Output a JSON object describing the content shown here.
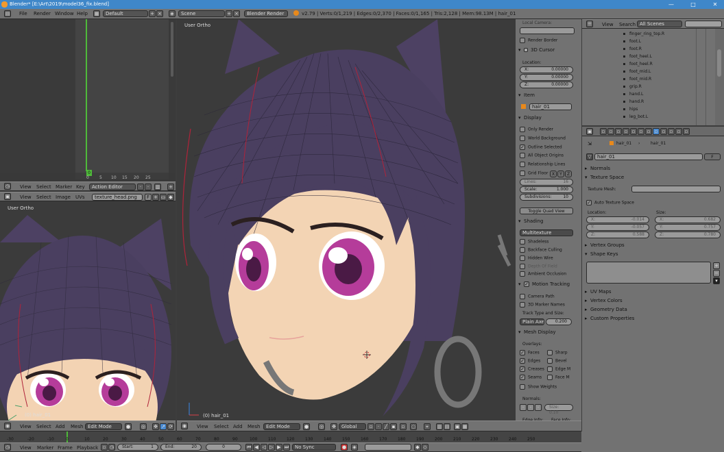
{
  "titlebar": {
    "title": "Blender* [E:\\Art\\2019\\model36_fix.blend]"
  },
  "infobar": {
    "menus": [
      "File",
      "Render",
      "Window",
      "Help"
    ],
    "layout": "Default",
    "scene": "Scene",
    "engine": "Blender Render",
    "stats": "v2.79 | Verts:0/1,219 | Edges:0/2,370 | Faces:0/1,165 | Tris:2,128 | Mem:98.13M | hair_01"
  },
  "timeline_editor": {
    "frame_badge": "0",
    "ticks": [
      "0",
      "5",
      "10",
      "15",
      "20",
      "25"
    ],
    "menus": [
      "View",
      "Select",
      "Marker",
      "Key"
    ],
    "mode": "Action Editor"
  },
  "image_editor": {
    "menus": [
      "View",
      "Select",
      "Image",
      "UVs"
    ],
    "image_name": "texture_head.png",
    "f_label": "F"
  },
  "left_view": {
    "label": "User Ortho",
    "object": "(0) hair_01",
    "menus": [
      "View",
      "Select",
      "Add",
      "Mesh"
    ],
    "mode": "Edit Mode"
  },
  "main_view": {
    "label": "User Ortho",
    "object": "(0) hair_01",
    "menus": [
      "View",
      "Select",
      "Add",
      "Mesh"
    ],
    "mode": "Edit Mode",
    "orientation": "Global"
  },
  "props": {
    "local_camera": "Local Camera:",
    "render_border": "Render Border",
    "cursor_title": "3D Cursor",
    "location_label": "Location:",
    "cursor": [
      {
        "axis": "X:",
        "value": "0.00000"
      },
      {
        "axis": "Y:",
        "value": "0.00000"
      },
      {
        "axis": "Z:",
        "value": "0.00000"
      }
    ],
    "item_title": "Item",
    "item_name": "hair_01",
    "display_title": "Display",
    "display_items": [
      {
        "label": "Only Render",
        "checked": false
      },
      {
        "label": "World Background",
        "checked": false
      },
      {
        "label": "Outline Selected",
        "checked": true
      },
      {
        "label": "All Object Origins",
        "checked": false
      },
      {
        "label": "Relationship Lines",
        "checked": false
      }
    ],
    "grid_floor": "Grid Floor",
    "axes": [
      "X",
      "Y",
      "Z"
    ],
    "lines": "Lines:",
    "lines_val": "16",
    "scale": "Scale:",
    "scale_val": "1.000",
    "subdivisions": "Subdivisions:",
    "subdivisions_val": "10",
    "toggle_quad": "Toggle Quad View",
    "shading_title": "Shading",
    "shading_mode": "Multitexture",
    "shading_items": [
      {
        "label": "Shadeless",
        "checked": false
      },
      {
        "label": "Backface Culling",
        "checked": false
      },
      {
        "label": "Hidden Wire",
        "checked": false
      },
      {
        "label": "Depth Of Field",
        "checked": false
      },
      {
        "label": "Ambient Occlusion",
        "checked": false
      }
    ],
    "motion_title": "Motion Tracking",
    "motion_items": [
      "Camera Path",
      "3D Marker Names"
    ],
    "track_label": "Track Type and Size:",
    "track_type": "Plain Axe",
    "track_size": "0.200",
    "mesh_display_title": "Mesh Display",
    "overlays": "Overlays:",
    "overlay_left": [
      {
        "label": "Faces",
        "checked": true
      },
      {
        "label": "Edges",
        "checked": true
      },
      {
        "label": "Creases",
        "checked": true
      },
      {
        "label": "Seams",
        "checked": true
      }
    ],
    "overlay_right": [
      "Sharp",
      "Bevel",
      "Edge M",
      "Face M"
    ],
    "show_weights": "Show Weights",
    "normals": "Normals:",
    "normal_size": "Size: 0.10",
    "edge_info": "Edge Info:",
    "face_info": "Face Info:"
  },
  "outliner": {
    "menus": [
      "View",
      "Search"
    ],
    "scope": "All Scenes",
    "items": [
      "finger_ring_top.R",
      "foot.L",
      "foot.R",
      "foot_heel.L",
      "foot_heel.R",
      "foot_mid.L",
      "foot_mid.R",
      "grip.R",
      "hand.L",
      "hand.R",
      "hips",
      "leg_bot.L"
    ]
  },
  "rprops": {
    "breadcrumb_obj": "hair_01",
    "breadcrumb_mesh": "hair_01",
    "datablock": "hair_01",
    "datablock_f": "F",
    "normals": "Normals",
    "texture_space": "Texture Space",
    "texture_mesh": "Texture Mesh:",
    "auto_texture": "Auto Texture Space",
    "loc_label": "Location:",
    "size_label": "Size:",
    "loc": [
      {
        "axis": "X:",
        "value": "-0.014"
      },
      {
        "axis": "Y:",
        "value": "-0.057"
      },
      {
        "axis": "Z:",
        "value": "0.588"
      }
    ],
    "size": [
      {
        "axis": "X:",
        "value": "0.682"
      },
      {
        "axis": "Y:",
        "value": "0.757"
      },
      {
        "axis": "Z:",
        "value": "0.780"
      }
    ],
    "vertex_groups": "Vertex Groups",
    "shape_keys": "Shape Keys",
    "uv_maps": "UV Maps",
    "vertex_colors": "Vertex Colors",
    "geometry_data": "Geometry Data",
    "custom_props": "Custom Properties"
  },
  "bottom_timeline": {
    "ruler": [
      "-30",
      "-20",
      "-10",
      "0",
      "10",
      "20",
      "30",
      "40",
      "50",
      "60",
      "70",
      "80",
      "90",
      "100",
      "110",
      "120",
      "130",
      "140",
      "150",
      "160",
      "170",
      "180",
      "190",
      "200",
      "210",
      "220",
      "230",
      "240",
      "250"
    ],
    "menus": [
      "View",
      "Marker",
      "Frame",
      "Playback"
    ],
    "start": "Start:",
    "start_val": "1",
    "end": "End:",
    "end_val": "20",
    "current": "0",
    "sync": "No Sync"
  }
}
